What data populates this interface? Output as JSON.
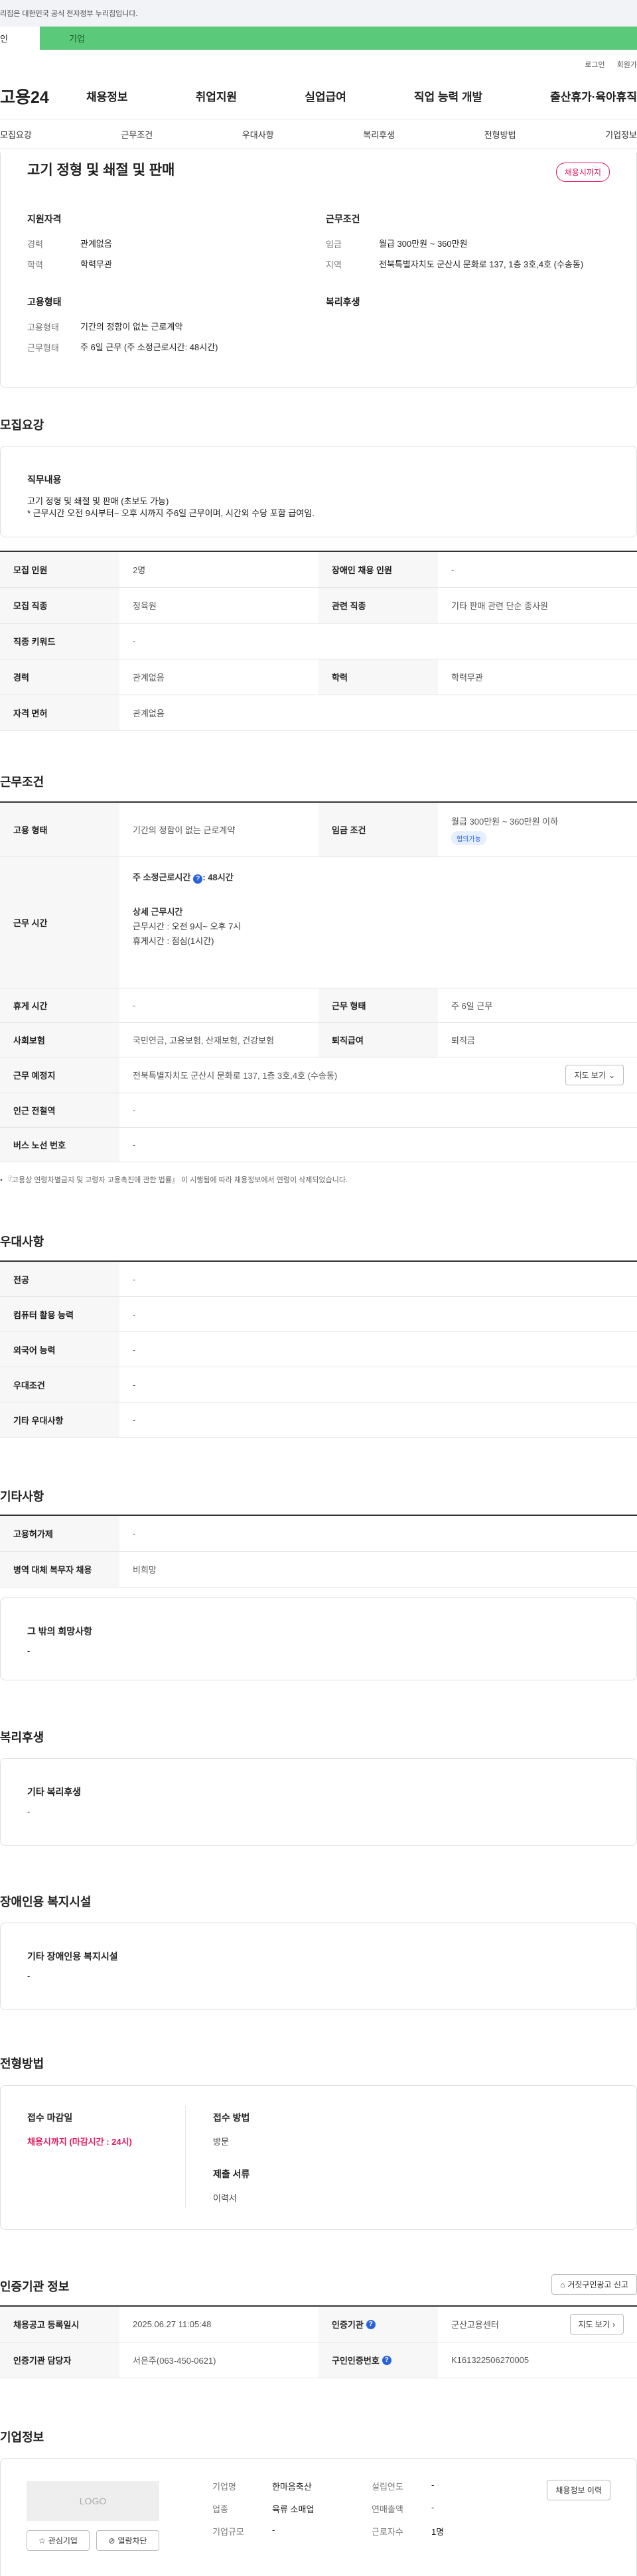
{
  "gov_banner": "리집은 대한민국 공식 전자정부 누리집입니다.",
  "user_tabs": [
    "인",
    "기업"
  ],
  "util_links": [
    "로그인",
    "회원가"
  ],
  "logo": "고용24",
  "gnb": [
    "채용정보",
    "취업지원",
    "실업급여",
    "직업 능력 개발",
    "출산휴가·육아휴직"
  ],
  "subnav": [
    "모집요강",
    "근무조건",
    "우대사항",
    "복리후생",
    "전형방법",
    "기업정보"
  ],
  "summary": {
    "title": "고기 정형 및 쇄절 및 판매",
    "badge": "채용시까지",
    "qual_h": "지원자격",
    "qual": [
      {
        "k": "경력",
        "v": "관계없음"
      },
      {
        "k": "학력",
        "v": "학력무관"
      }
    ],
    "work_h": "근무조건",
    "work": [
      {
        "k": "임금",
        "v": "월급 300만원 ~ 360만원"
      },
      {
        "k": "지역",
        "v": "전북특별자치도 군산시 문화로 137, 1층 3호,4호 (수송동)"
      }
    ],
    "emp_h": "고용형태",
    "emp": [
      {
        "k": "고용형태",
        "v": "기간의 정함이 없는 근로계약"
      },
      {
        "k": "근무형태",
        "v": "주 6일 근무 (주 소정근로시간: 48시간)"
      }
    ],
    "welfare_h": "복리후생"
  },
  "recruit": {
    "title": "모집요강",
    "duty_h": "직무내용",
    "duty_lines": [
      "고기 정형 및 쇄절 및 판매 (초보도 가능)",
      "* 근무시간 오전 9시부터~ 오후 시까지 주6일 근무이며, 시간외 수당 포함 급여임."
    ],
    "rows": [
      {
        "h1": "모집 인원",
        "v1": "2명",
        "h2": "장애인 채용 인원",
        "v2": "-"
      },
      {
        "h1": "모집 직종",
        "v1": "정육원",
        "h2": "관련 직종",
        "v2": "기타 판매 관련 단순 종사원"
      },
      {
        "h1": "직종 키워드",
        "v1": "-"
      },
      {
        "h1": "경력",
        "v1": "관계없음",
        "h2": "학력",
        "v2": "학력무관"
      },
      {
        "h1": "자격 면허",
        "v1": "관계없음"
      }
    ]
  },
  "conditions": {
    "title": "근무조건",
    "emp_type_h": "고용 형태",
    "emp_type": "기간의 정함이 없는 근로계약",
    "wage_h": "임금 조건",
    "wage": "월급 300만원 ~ 360만원 이하",
    "wage_badge": "협의가능",
    "hours_h": "근무 시간",
    "hours_main": "주 소정근로시간",
    "hours_main_val": ": 48시간",
    "hours_detail_h": "상세 근무시간",
    "hours_detail": [
      "근무시간 : 오전 9시~ 오후 7시",
      "휴게시간 : 점심(1시간)"
    ],
    "rest_h": "휴게 시간",
    "rest": "-",
    "worktype_h": "근무 형태",
    "worktype": "주 6일 근무",
    "insurance_h": "사회보험",
    "insurance": "국민연금, 고용보험, 산재보험, 건강보험",
    "retire_h": "퇴직급여",
    "retire": "퇴직금",
    "place_h": "근무 예정지",
    "place": "전북특별자치도 군산시 문화로 137, 1층 3호,4호 (수송동)",
    "map_btn": "지도 보기",
    "subway_h": "인근 전철역",
    "subway": "-",
    "bus_h": "버스 노선 번호",
    "bus": "-",
    "note": "『고용상 연령차별금지 및 고령자 고용촉진에 관한 법률』 이 시행됨에 따라 채용정보에서 연령이 삭제되었습니다."
  },
  "prefer": {
    "title": "우대사항",
    "rows": [
      {
        "h": "전공",
        "v": "-"
      },
      {
        "h": "컴퓨터 활용 능력",
        "v": "-"
      },
      {
        "h": "외국어 능력",
        "v": "-"
      },
      {
        "h": "우대조건",
        "v": "-"
      },
      {
        "h": "기타 우대사항",
        "v": "-"
      }
    ]
  },
  "other": {
    "title": "기타사항",
    "rows": [
      {
        "h": "고용허가제",
        "v": "-"
      },
      {
        "h": "병역 대체 복무자 채용",
        "v": "비희망"
      }
    ],
    "wish_h": "그 밖의 희망사항",
    "wish": "-"
  },
  "welfare": {
    "title": "복리후생",
    "h": "기타 복리후생",
    "v": "-"
  },
  "disabled": {
    "title": "장애인용 복지시설",
    "h": "기타 장애인용 복지시설",
    "v": "-"
  },
  "selection": {
    "title": "전형방법",
    "deadline_h": "접수 마감일",
    "deadline": "채용시까지 (마감시간 : 24시)",
    "method_h": "접수 방법",
    "method": "방문",
    "docs_h": "제출 서류",
    "docs": "이력서"
  },
  "cert": {
    "title": "인증기관 정보",
    "report_btn": "거짓구인광고 신고",
    "reg_h": "채용공고 등록일시",
    "reg": "2025.06.27 11:05:48",
    "org_h": "인증기관",
    "org": "군산고용센터",
    "map_btn": "지도 보기",
    "mgr_h": "인증기관 담당자",
    "mgr": "서은주(063-450-0621)",
    "num_h": "구인인증번호",
    "num": "K161322506270005"
  },
  "company": {
    "title": "기업정보",
    "logo": "LOGO",
    "fav_btn": "관심기업",
    "block_btn": "열람차단",
    "history_btn": "채용정보 이력",
    "rows": [
      {
        "h1": "기업명",
        "v1": "한마음축산",
        "h2": "설립연도",
        "v2": "-"
      },
      {
        "h1": "업종",
        "v1": "육류 소매업",
        "h2": "연매출액",
        "v2": "-"
      },
      {
        "h1": "기업규모",
        "v1": "-",
        "h2": "근로자수",
        "v2": "1명"
      }
    ]
  }
}
